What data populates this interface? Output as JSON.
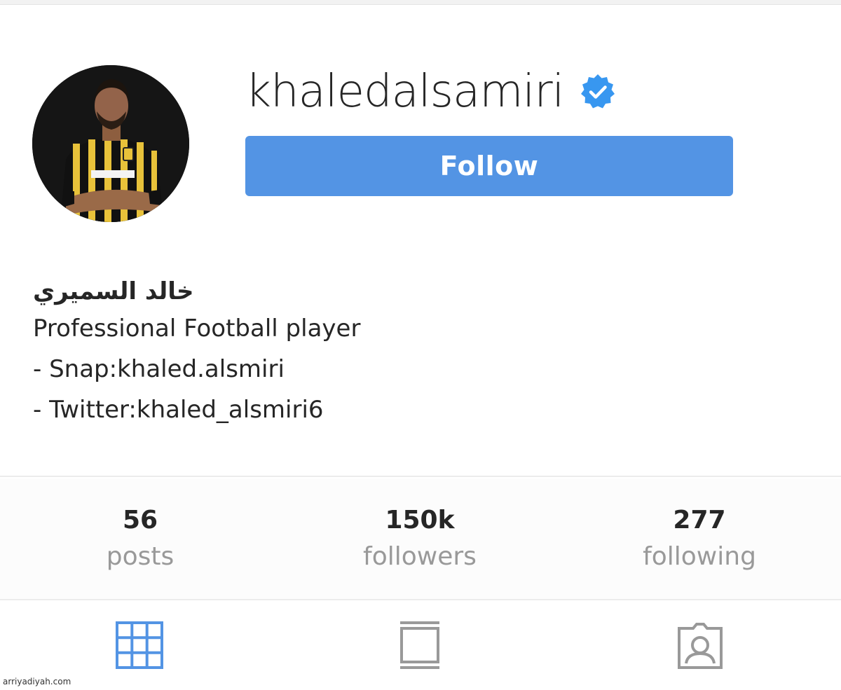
{
  "profile": {
    "username": "khaledalsamiri",
    "verified_icon": "verified-badge-icon",
    "follow_label": "Follow",
    "display_name": "خالد السميري",
    "bio_lines": [
      "Professional Football player",
      "- Snap:khaled.alsmiri",
      "- Twitter:khaled_alsmiri6"
    ]
  },
  "stats": [
    {
      "value": "56",
      "label": "posts"
    },
    {
      "value": "150k",
      "label": "followers"
    },
    {
      "value": "277",
      "label": "following"
    }
  ],
  "tabs": [
    {
      "icon": "grid-icon",
      "active": true
    },
    {
      "icon": "feed-list-icon",
      "active": false
    },
    {
      "icon": "tagged-person-icon",
      "active": false
    }
  ],
  "watermark": "arriyadiyah.com",
  "colors": {
    "accent": "#5394e4",
    "verified": "#3897f0",
    "text": "#262626",
    "muted": "#999999",
    "tab_active": "#5394e4",
    "tab_inactive": "#999999"
  }
}
